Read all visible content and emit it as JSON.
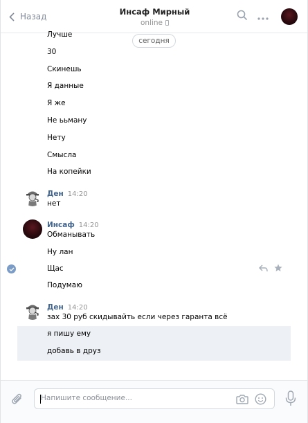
{
  "header": {
    "back_label": "Назад",
    "title": "Инсаф Мирный",
    "status": "online",
    "icons": [
      "chevron-left-icon",
      "search-icon",
      "more-icon",
      "avatar"
    ]
  },
  "date_pill": "сегодня",
  "messages_top": [
    "Лучше",
    "30",
    "Скинешь",
    "Я данные",
    "Я же",
    "Не ььману",
    "Нету",
    "Смысла",
    "На копейки"
  ],
  "group1": {
    "author": "Ден",
    "time": "14:20",
    "lines": [
      "нет"
    ]
  },
  "group2": {
    "author": "Инсаф",
    "time": "14:20",
    "lines": [
      "Обманывать",
      "Ну лан",
      "Щас",
      "Подумаю"
    ]
  },
  "group3": {
    "author": "Ден",
    "time": "14:20",
    "lines": [
      "зах 30 руб скидывайть если через гаранта всё",
      "я пишу ему",
      "добавь в друз"
    ]
  },
  "composer": {
    "placeholder": "Напишите сообщение..."
  },
  "colors": {
    "author": "#42648b",
    "accent": "#5181b8",
    "highlight": "#edf0f5"
  }
}
